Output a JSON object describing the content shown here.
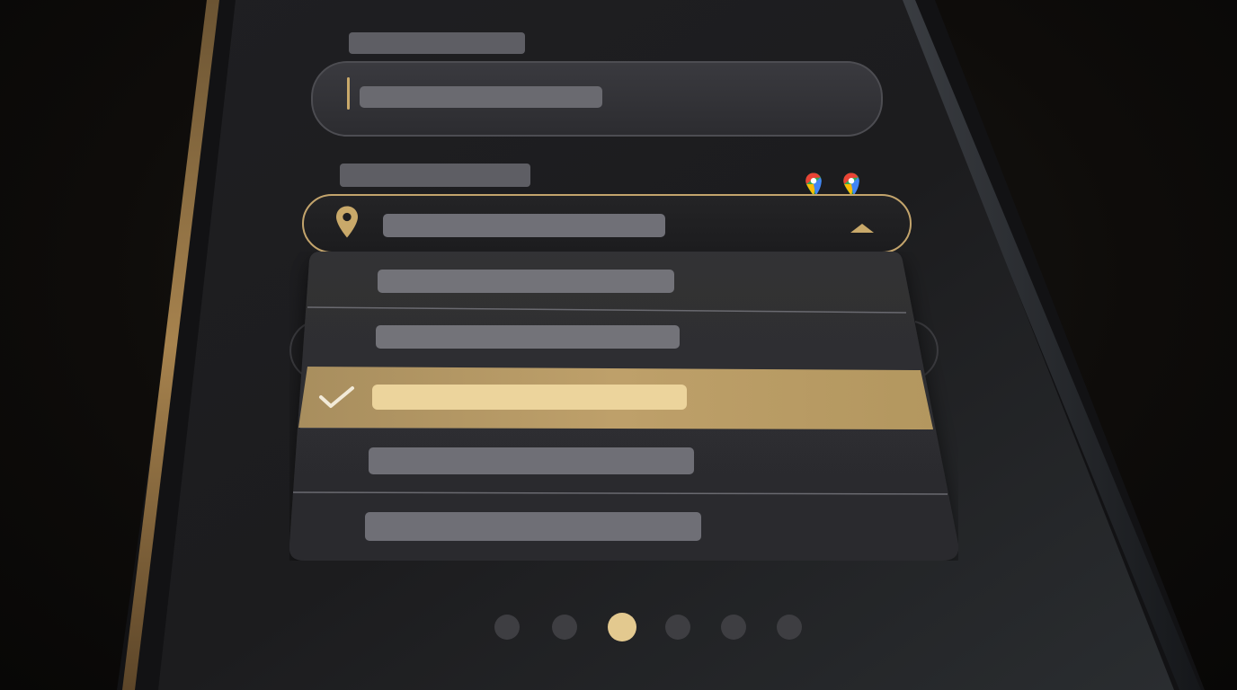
{
  "colors": {
    "accent_gold": "#c9a96a",
    "selected_row": "#b59a66",
    "placeholder_bar": "#6f6f76",
    "panel_bg": "#2e2e31",
    "screen_bg": "#1e1e20"
  },
  "form": {
    "text_field": {
      "label": "",
      "value": "",
      "has_caret": true
    },
    "location_field": {
      "label": "",
      "value": "",
      "leading_icon": "location-pin-icon",
      "trailing_icon": "caret-up-icon",
      "badges": [
        "google-maps-pin-icon",
        "google-maps-pin-icon"
      ],
      "expanded": true
    }
  },
  "dropdown": {
    "options": [
      {
        "label": "",
        "selected": false
      },
      {
        "label": "",
        "selected": false
      },
      {
        "label": "",
        "selected": true,
        "icon": "checkmark-icon"
      },
      {
        "label": "",
        "selected": false
      },
      {
        "label": "",
        "selected": false
      }
    ]
  },
  "pager": {
    "count": 6,
    "active_index": 2
  }
}
